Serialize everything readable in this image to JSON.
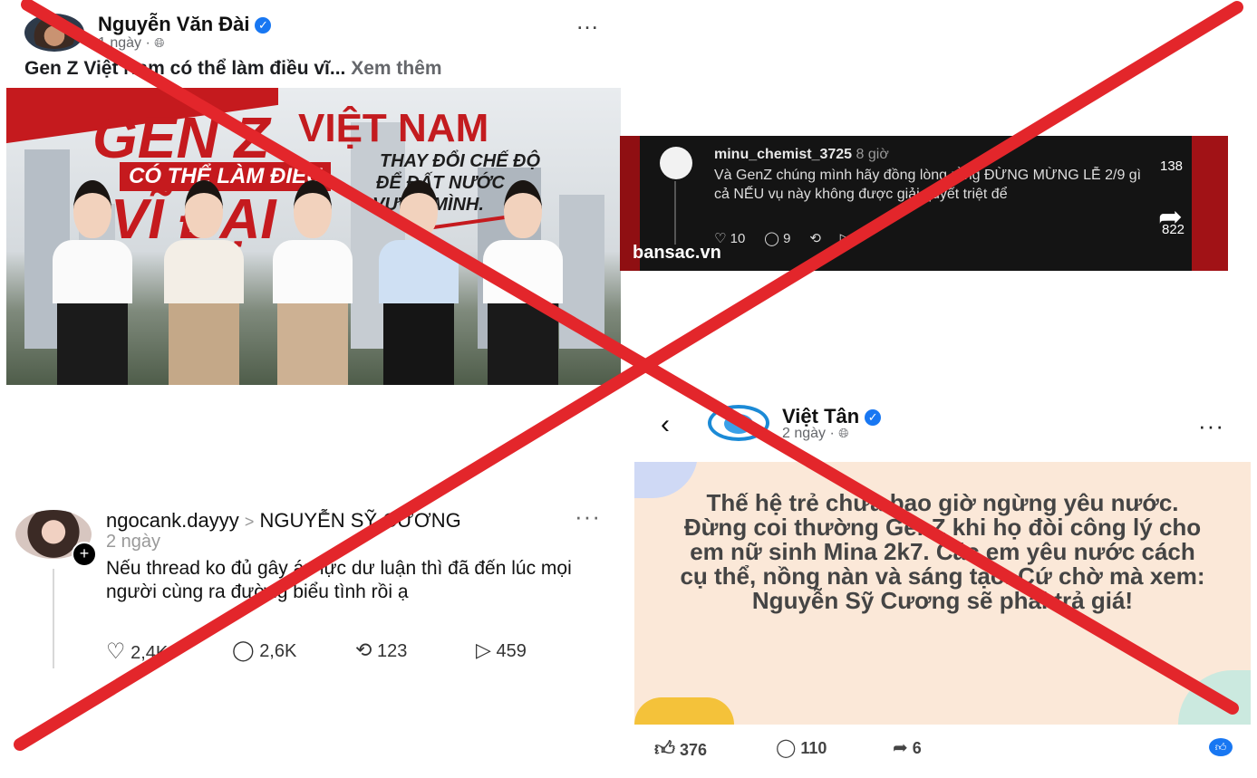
{
  "post1": {
    "author": "Nguyễn Văn Đài",
    "time": "1 ngày ·",
    "more_icon": "…",
    "text": "Gen Z Việt Nam có thể làm điều vĩ...",
    "see_more": "Xem thêm",
    "image": {
      "line1": "GEN Z",
      "line2": "VIỆT NAM",
      "line3": "CÓ THỂ LÀM ĐIỀU",
      "line4": "VĨ ĐẠI",
      "tag1": "THAY ĐỔI CHẾ ĐỘ",
      "tag2": "ĐỂ ĐẤT NƯỚC",
      "tag3": "VƯƠN MÌNH."
    }
  },
  "post2": {
    "username": "minu_chemist_3725",
    "time": "8 giờ",
    "text": "Và GenZ chúng mình hãy đồng lòng rằng ĐỪNG MỪNG LỄ 2/9 gì cả NẾU vụ này không được giải quyết triệt để",
    "likes": "10",
    "comments": "9",
    "side_count_top": "138",
    "side_count_bottom": "822",
    "watermark": "bansac.vn"
  },
  "post3": {
    "username": "ngocank.dayyy",
    "separator": ">",
    "tagged": "NGUYỄN SỸ CƯƠNG",
    "time": "2 ngày",
    "text": "Nếu thread ko đủ gây áp lực dư luận thì đã đến lúc mọi người cùng ra đường biểu tình rồi ạ",
    "likes": "2,4K",
    "comments": "2,6K",
    "reposts": "123",
    "shares": "459"
  },
  "post4": {
    "author": "Việt Tân",
    "time": "2 ngày ·",
    "text": "Thế hệ trẻ chưa bao giờ ngừng yêu nước. Đừng coi thường GenZ khi họ đòi công lý cho em nữ sinh Mina 2k7. Các em yêu nước cách cụ thể, nồng nàn và sáng tạo. Cứ chờ mà xem: Nguyễn Sỹ Cương sẽ phải trả giá!",
    "likes": "376",
    "comments": "110",
    "shares": "6"
  },
  "colors": {
    "cross": "#e3262b",
    "facebook_blue": "#1877f2",
    "red_brand": "#c51a1e"
  }
}
